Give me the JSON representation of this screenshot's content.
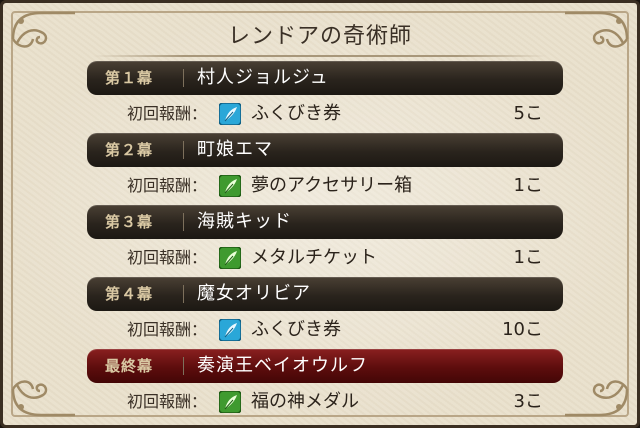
{
  "title": "レンドアの奇術師",
  "reward_label": "初回報酬：",
  "chapters": [
    {
      "label": "第１幕",
      "name": "村人ジョルジュ",
      "reward": {
        "icon": "blue-feather-icon",
        "item": "ふくびき券",
        "qty": "5こ"
      }
    },
    {
      "label": "第２幕",
      "name": "町娘エマ",
      "reward": {
        "icon": "green-feather-icon",
        "item": "夢のアクセサリー箱",
        "qty": "1こ"
      }
    },
    {
      "label": "第３幕",
      "name": "海賊キッド",
      "reward": {
        "icon": "green-feather-icon",
        "item": "メタルチケット",
        "qty": "1こ"
      }
    },
    {
      "label": "第４幕",
      "name": "魔女オリビア",
      "reward": {
        "icon": "blue-feather-icon",
        "item": "ふくびき券",
        "qty": "10こ"
      }
    },
    {
      "label": "最終幕",
      "name": "奏演王ベイオウルフ",
      "reward": {
        "icon": "green-feather-icon",
        "item": "福の神メダル",
        "qty": "3こ"
      }
    }
  ],
  "colors": {
    "panel_bg": "#e9e0cc",
    "chapter_bar": "#2a241d",
    "final_bar": "#5d0d0d",
    "blue_icon": "#2aa7d8",
    "green_icon": "#3f9a2f"
  }
}
